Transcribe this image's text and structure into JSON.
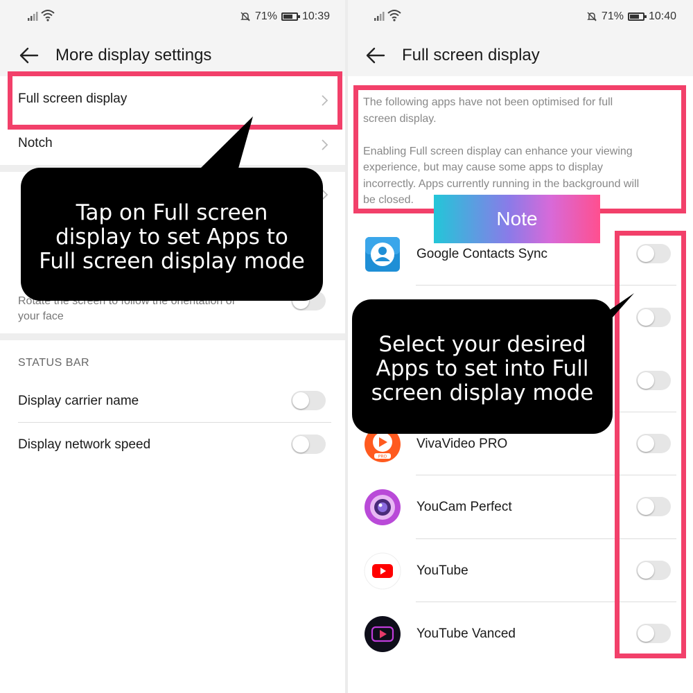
{
  "left": {
    "status": {
      "battery": "71%",
      "time": "10:39",
      "battery_level": 0.71
    },
    "title": "More display settings",
    "items": [
      {
        "label": "Full screen display"
      },
      {
        "label": "Notch"
      }
    ],
    "partial_item_desc_line1": "Rotate the screen to follow the orientation of",
    "partial_item_desc_line2": "your face",
    "status_bar_section": "STATUS BAR",
    "toggles": [
      {
        "label": "Display carrier name",
        "on": false
      },
      {
        "label": "Display network speed",
        "on": false
      }
    ],
    "callout": {
      "line1": "Tap on Full screen",
      "line2": "display to set Apps to",
      "line3": "Full screen display mode"
    }
  },
  "right": {
    "status": {
      "battery": "71%",
      "time": "10:40",
      "battery_level": 0.71
    },
    "title": "Full screen display",
    "note_lines": [
      "The following apps have not been optimised for full",
      "screen display.",
      "",
      "Enabling Full screen display can enhance your viewing",
      "experience, but may cause some apps to display",
      "incorrectly. Apps currently running in the background will",
      "be closed."
    ],
    "note_banner": "Note",
    "apps": [
      {
        "name": "Google Contacts Sync",
        "icon": "contacts-sync-icon",
        "on": false
      },
      {
        "name": "",
        "icon": "",
        "on": false
      },
      {
        "name": "",
        "icon": "",
        "on": false
      },
      {
        "name": "VivaVideo PRO",
        "icon": "vivavideo-icon",
        "on": false
      },
      {
        "name": "YouCam Perfect",
        "icon": "youcam-icon",
        "on": false
      },
      {
        "name": "YouTube",
        "icon": "youtube-icon",
        "on": false
      },
      {
        "name": "YouTube Vanced",
        "icon": "youtube-vanced-icon",
        "on": false
      }
    ],
    "callout": {
      "line1": "Select your desired",
      "line2": "Apps to set into Full",
      "line3": "screen display mode"
    }
  },
  "colors": {
    "highlight": "#f2406a",
    "callout": "#000000",
    "status_bg": "#f4f4f4"
  }
}
